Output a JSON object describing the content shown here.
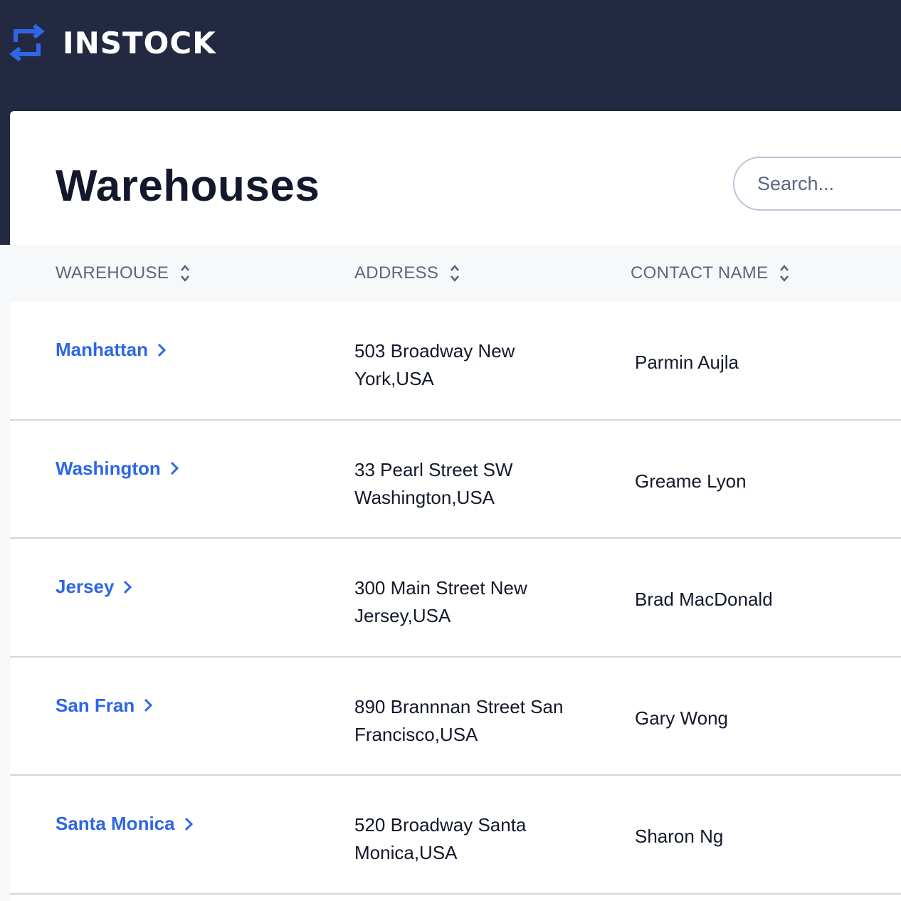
{
  "brand": {
    "name": "INSTOCK",
    "icon": "swap-arrows-icon",
    "accent": "#2e66e6"
  },
  "page": {
    "title": "Warehouses"
  },
  "search": {
    "placeholder": "Search..."
  },
  "table": {
    "columns": [
      {
        "label": "WAREHOUSE",
        "icon": "sort-icon"
      },
      {
        "label": "ADDRESS",
        "icon": "sort-icon"
      },
      {
        "label": "CONTACT NAME",
        "icon": "sort-icon"
      }
    ],
    "rows": [
      {
        "warehouse": "Manhattan",
        "address_line1": "503 Broadway New",
        "address_line2": "York,USA",
        "contact": "Parmin Aujla"
      },
      {
        "warehouse": "Washington",
        "address_line1": "33 Pearl Street SW",
        "address_line2": "Washington,USA",
        "contact": "Greame Lyon"
      },
      {
        "warehouse": "Jersey",
        "address_line1": "300 Main Street New",
        "address_line2": "Jersey,USA",
        "contact": "Brad MacDonald"
      },
      {
        "warehouse": "San Fran",
        "address_line1": "890 Brannnan Street San",
        "address_line2": "Francisco,USA",
        "contact": "Gary Wong"
      },
      {
        "warehouse": "Santa Monica",
        "address_line1": "520 Broadway Santa",
        "address_line2": "Monica,USA",
        "contact": "Sharon Ng"
      }
    ]
  }
}
